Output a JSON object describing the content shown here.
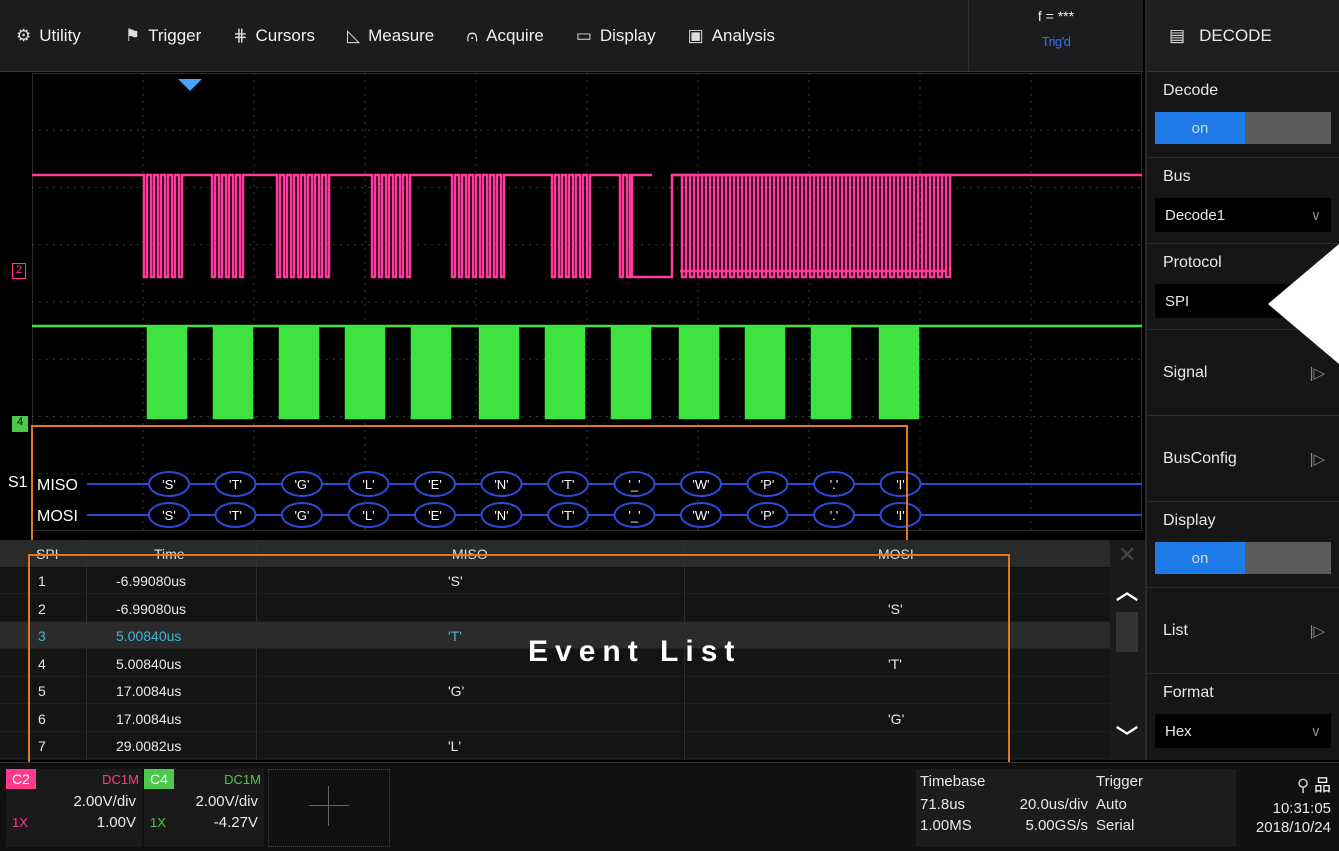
{
  "menu": {
    "items": [
      {
        "icon": "gear-icon",
        "glyph": "⚙",
        "label": "Utility"
      },
      {
        "icon": "flag-icon",
        "glyph": "⚑",
        "label": "Trigger"
      },
      {
        "icon": "cursors-icon",
        "glyph": "⋕",
        "label": "Cursors"
      },
      {
        "icon": "measure-icon",
        "glyph": "◺",
        "label": "Measure"
      },
      {
        "icon": "acquire-icon",
        "glyph": "⩀",
        "label": "Acquire"
      },
      {
        "icon": "display-icon",
        "glyph": "▭",
        "label": "Display"
      },
      {
        "icon": "analysis-icon",
        "glyph": "▣",
        "label": "Analysis"
      }
    ],
    "freq": "f = ***",
    "trig_state": "Trig'd"
  },
  "panel": {
    "title": "DECODE",
    "decode_label": "Decode",
    "decode_value": "on",
    "bus_label": "Bus",
    "bus_value": "Decode1",
    "protocol_label": "Protocol",
    "protocol_value": "SPI",
    "signal_label": "Signal",
    "busconfig_label": "BusConfig",
    "display_label": "Display",
    "display_value": "on",
    "list_label": "List",
    "format_label": "Format",
    "format_value": "Hex"
  },
  "decode_bus": {
    "name": "S1",
    "rows": [
      "MISO",
      "MOSI"
    ],
    "symbols": [
      "'S'",
      "'T'",
      "'G'",
      "'L'",
      "'E'",
      "'N'",
      "'T'",
      "'_'",
      "'W'",
      "'P'",
      "'.'",
      "'I'"
    ]
  },
  "markers": {
    "ch2": "2",
    "ch4": "4"
  },
  "event_list": {
    "title": "Event List",
    "headers": [
      "SPI",
      "Time",
      "MISO",
      "MOSI"
    ],
    "rows": [
      [
        "1",
        "-6.99080us",
        "'S'",
        ""
      ],
      [
        "2",
        "-6.99080us",
        "",
        "'S'"
      ],
      [
        "3",
        "5.00840us",
        "'T'",
        ""
      ],
      [
        "4",
        "5.00840us",
        "",
        "'T'"
      ],
      [
        "5",
        "17.0084us",
        "'G'",
        ""
      ],
      [
        "6",
        "17.0084us",
        "",
        "'G'"
      ],
      [
        "7",
        "29.0082us",
        "'L'",
        ""
      ]
    ],
    "highlighted_row": 3
  },
  "bottom": {
    "c2": {
      "name": "C2",
      "coupling": "DC1M",
      "scale": "2.00V/div",
      "probe": "1X",
      "offset": "1.00V",
      "color": "#ff3a8c"
    },
    "c4": {
      "name": "C4",
      "coupling": "DC1M",
      "scale": "2.00V/div",
      "probe": "1X",
      "offset": "-4.27V",
      "color": "#4cc84c"
    },
    "timebase_label": "Timebase",
    "delay": "71.8us",
    "tdiv": "20.0us/div",
    "mem": "1.00MS",
    "srate": "5.00GS/s",
    "trigger_label": "Trigger",
    "trig_mode": "Auto",
    "trig_type": "Serial",
    "time": "10:31:05",
    "date": "2018/10/24"
  }
}
